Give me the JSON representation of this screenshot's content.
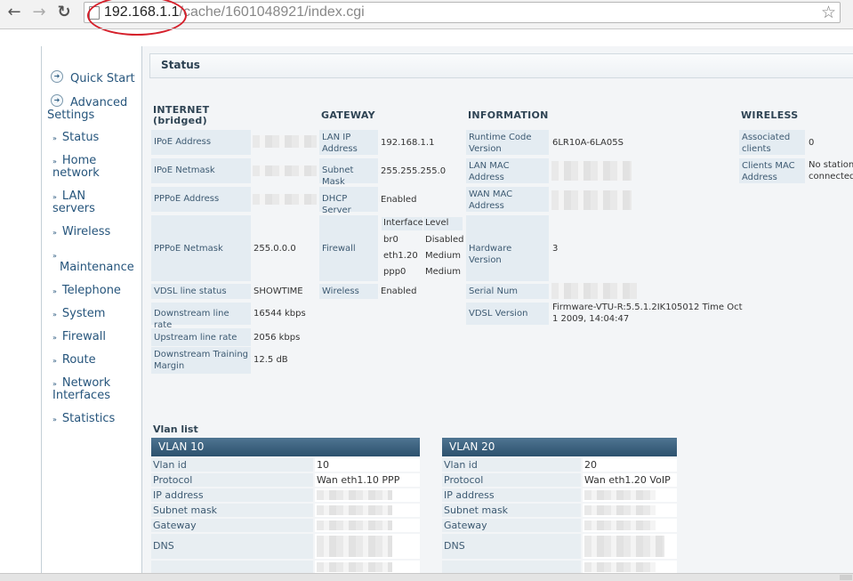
{
  "browser": {
    "url_host": "192.168.1.1",
    "url_path": "/cache/1601048921/index.cgi"
  },
  "sidebar": {
    "quick_start": "Quick Start",
    "advanced_line1": "Advanced",
    "advanced_line2": "Settings",
    "items": [
      {
        "label1": "Status"
      },
      {
        "label1": "Home",
        "label2": "network"
      },
      {
        "label1": "LAN",
        "label2": "servers"
      },
      {
        "label1": "Wireless"
      },
      {
        "label1": "",
        "label2": "Maintenance"
      },
      {
        "label1": "Telephone"
      },
      {
        "label1": "System"
      },
      {
        "label1": "Firewall"
      },
      {
        "label1": "Route"
      },
      {
        "label1": "Network",
        "label2": "Interfaces"
      },
      {
        "label1": "Statistics"
      }
    ]
  },
  "main": {
    "title": "Status",
    "internet": {
      "heading1": "INTERNET",
      "heading2": "(bridged)",
      "rows": [
        {
          "label": "IPoE Address",
          "value": ""
        },
        {
          "label": "IPoE Netmask",
          "value": ""
        },
        {
          "label": "PPPoE Address",
          "value": ""
        },
        {
          "label": "PPPoE Netmask",
          "value": "255.0.0.0"
        },
        {
          "label": "VDSL line status",
          "value": "SHOWTIME"
        },
        {
          "label": "Downstream line rate",
          "value": "16544 kbps"
        },
        {
          "label": "Upstream line rate",
          "value": "2056 kbps"
        },
        {
          "label1": "Downstream Training",
          "label2": "Margin",
          "value": "12.5 dB"
        }
      ]
    },
    "gateway": {
      "heading": "GATEWAY",
      "lan_ip_label1": "LAN IP",
      "lan_ip_label2": "Address",
      "lan_ip_value": "192.168.1.1",
      "subnet_label": "Subnet Mask",
      "subnet_value": "255.255.255.0",
      "dhcp_label": "DHCP Server",
      "dhcp_value": "Enabled",
      "firewall_label": "Firewall",
      "firewall_table": {
        "col1": "Interface",
        "col2": "Level",
        "rows": [
          {
            "iface": "br0",
            "level": "Disabled"
          },
          {
            "iface": "eth1.20",
            "level": "Medium"
          },
          {
            "iface": "ppp0",
            "level": "Medium"
          }
        ]
      },
      "wireless_label": "Wireless",
      "wireless_value": "Enabled"
    },
    "information": {
      "heading": "INFORMATION",
      "runtime_label1": "Runtime Code",
      "runtime_label2": "Version",
      "runtime_value": "6LR10A-6LA05S",
      "lanmac_label1": "LAN MAC",
      "lanmac_label2": "Address",
      "wanmac_label1": "WAN MAC",
      "wanmac_label2": "Address",
      "hw_label": "Hardware Version",
      "hw_value": "3",
      "serial_label": "Serial Num",
      "vdsl_label": "VDSL Version",
      "vdsl_value1": "Firmware-VTU-R:5.5.1.2IK105012 Time Oct",
      "vdsl_value2": "1 2009, 14:04:47"
    },
    "wireless": {
      "heading": "WIRELESS",
      "assoc_label1": "Associated",
      "assoc_label2": "clients",
      "assoc_value": "0",
      "clientsmac_label1": "Clients MAC",
      "clientsmac_label2": "Address",
      "clientsmac_value1": "No station",
      "clientsmac_value2": "connected"
    },
    "vlan_list_title": "Vlan list",
    "vlans": [
      {
        "name": "VLAN 10",
        "vlan_id_label": "Vlan id",
        "vlan_id": "10",
        "protocol_label": "Protocol",
        "protocol": "Wan eth1.10 PPP",
        "ip_label": "IP address",
        "subnet_label": "Subnet mask",
        "gateway_label": "Gateway",
        "dns_label": "DNS"
      },
      {
        "name": "VLAN 20",
        "vlan_id_label": "Vlan id",
        "vlan_id": "20",
        "protocol_label": "Protocol",
        "protocol": "Wan eth1.20 VoIP",
        "ip_label": "IP address",
        "subnet_label": "Subnet mask",
        "gateway_label": "Gateway",
        "dns_label": "DNS"
      }
    ]
  }
}
